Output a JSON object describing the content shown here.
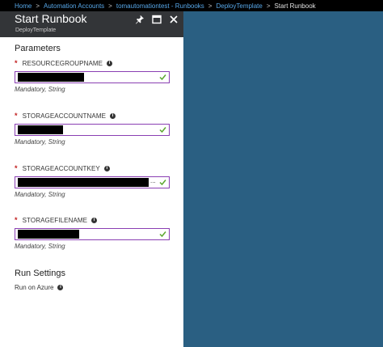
{
  "breadcrumb": {
    "items": [
      "Home",
      "Automation Accounts",
      "tomautomationtest - Runbooks",
      "DeployTemplate"
    ],
    "current": "Start Runbook"
  },
  "blade": {
    "title": "Start Runbook",
    "subtitle": "DeployTemplate"
  },
  "parameters": {
    "heading": "Parameters",
    "fields": [
      {
        "label": "RESOURCEGROUPNAME",
        "hint": "Mandatory, String"
      },
      {
        "label": "STORAGEACCOUNTNAME",
        "hint": "Mandatory, String"
      },
      {
        "label": "STORAGEACCOUNTKEY",
        "hint": "Mandatory, String",
        "value_suffix": "..."
      },
      {
        "label": "STORAGEFILENAME",
        "hint": "Mandatory, String"
      }
    ]
  },
  "run_settings": {
    "heading": "Run Settings",
    "run_on": "Run on Azure"
  },
  "colors": {
    "background": "#2a5f82",
    "header": "#333538",
    "input_border": "#8a3fb3",
    "check": "#5ba72e",
    "required": "#c11f1f",
    "link": "#57a7e8"
  },
  "icons": [
    "pin-icon",
    "maximize-icon",
    "close-icon",
    "info-icon",
    "check-icon"
  ]
}
